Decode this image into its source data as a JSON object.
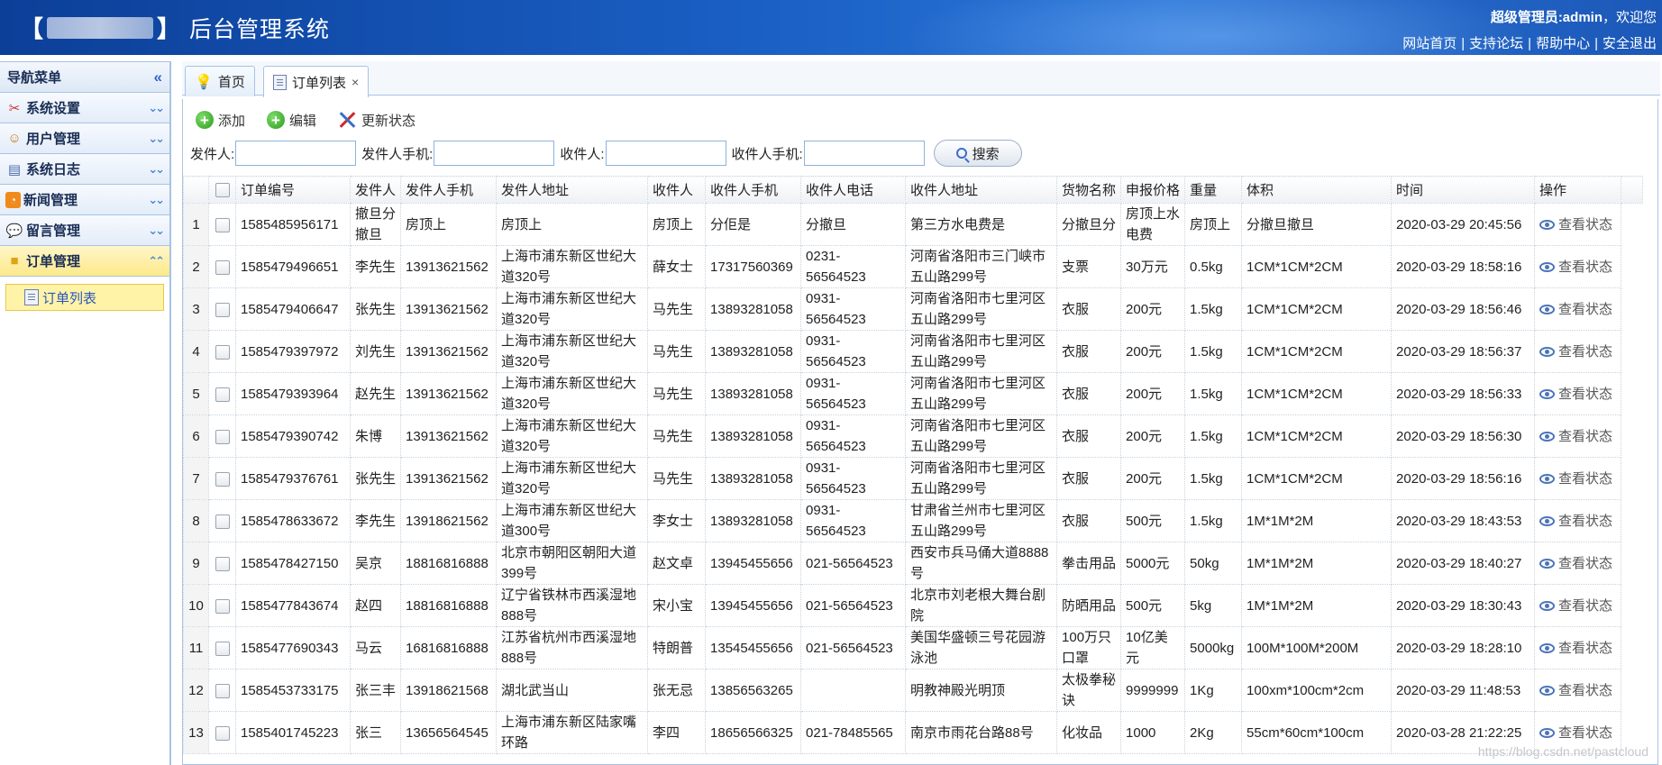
{
  "header": {
    "brand_bracket_left": "【",
    "brand_bracket_right": "】",
    "title": "后台管理系统",
    "welcome_user": "超级管理员:admin",
    "welcome_suffix": "，欢迎您",
    "links": [
      "网站首页",
      "支持论坛",
      "帮助中心",
      "安全退出"
    ]
  },
  "sidebar": {
    "title": "导航菜单",
    "items": [
      {
        "label": "系统设置",
        "icon": "tools-icon"
      },
      {
        "label": "用户管理",
        "icon": "users-icon"
      },
      {
        "label": "系统日志",
        "icon": "log-icon"
      },
      {
        "label": "新闻管理",
        "icon": "rss-icon"
      },
      {
        "label": "留言管理",
        "icon": "comment-icon"
      },
      {
        "label": "订单管理",
        "icon": "folder-icon"
      }
    ],
    "sub_item": "订单列表"
  },
  "tabs": [
    {
      "label": "首页"
    },
    {
      "label": "订单列表"
    }
  ],
  "toolbar": {
    "add": "添加",
    "edit": "编辑",
    "update_status": "更新状态"
  },
  "search": {
    "sender_label": "发件人:",
    "sender_phone_label": "发件人手机:",
    "receiver_label": "收件人:",
    "receiver_phone_label": "收件人手机:",
    "button": "搜索"
  },
  "table": {
    "columns": [
      "订单编号",
      "发件人",
      "发件人手机",
      "发件人地址",
      "收件人",
      "收件人手机",
      "收件人电话",
      "收件人地址",
      "货物名称",
      "申报价格",
      "重量",
      "体积",
      "时间",
      "操作"
    ],
    "action_label": "查看状态",
    "rows": [
      {
        "n": "1",
        "id": "1585485956171",
        "sender": "撤旦分撤旦",
        "sphone": "房顶上",
        "saddr": "房顶上",
        "receiver": "房顶上",
        "rphone": "分佢是",
        "rtel": "分撤旦",
        "raddr": "第三方水电费是",
        "goods": "分撤旦分",
        "price": "房顶上水电费",
        "weight": "房顶上",
        "volume": "分撤旦撤旦",
        "time": "2020-03-29 20:45:56"
      },
      {
        "n": "2",
        "id": "1585479496651",
        "sender": "李先生",
        "sphone": "13913621562",
        "saddr": "上海市浦东新区世纪大道320号",
        "receiver": "薛女士",
        "rphone": "17317560369",
        "rtel": "0231-56564523",
        "raddr": "河南省洛阳市三门峡市五山路299号",
        "goods": "支票",
        "price": "30万元",
        "weight": "0.5kg",
        "volume": "1CM*1CM*2CM",
        "time": "2020-03-29 18:58:16"
      },
      {
        "n": "3",
        "id": "1585479406647",
        "sender": "张先生",
        "sphone": "13913621562",
        "saddr": "上海市浦东新区世纪大道320号",
        "receiver": "马先生",
        "rphone": "13893281058",
        "rtel": "0931-56564523",
        "raddr": "河南省洛阳市七里河区五山路299号",
        "goods": "衣服",
        "price": "200元",
        "weight": "1.5kg",
        "volume": "1CM*1CM*2CM",
        "time": "2020-03-29 18:56:46"
      },
      {
        "n": "4",
        "id": "1585479397972",
        "sender": "刘先生",
        "sphone": "13913621562",
        "saddr": "上海市浦东新区世纪大道320号",
        "receiver": "马先生",
        "rphone": "13893281058",
        "rtel": "0931-56564523",
        "raddr": "河南省洛阳市七里河区五山路299号",
        "goods": "衣服",
        "price": "200元",
        "weight": "1.5kg",
        "volume": "1CM*1CM*2CM",
        "time": "2020-03-29 18:56:37"
      },
      {
        "n": "5",
        "id": "1585479393964",
        "sender": "赵先生",
        "sphone": "13913621562",
        "saddr": "上海市浦东新区世纪大道320号",
        "receiver": "马先生",
        "rphone": "13893281058",
        "rtel": "0931-56564523",
        "raddr": "河南省洛阳市七里河区五山路299号",
        "goods": "衣服",
        "price": "200元",
        "weight": "1.5kg",
        "volume": "1CM*1CM*2CM",
        "time": "2020-03-29 18:56:33"
      },
      {
        "n": "6",
        "id": "1585479390742",
        "sender": "朱博",
        "sphone": "13913621562",
        "saddr": "上海市浦东新区世纪大道320号",
        "receiver": "马先生",
        "rphone": "13893281058",
        "rtel": "0931-56564523",
        "raddr": "河南省洛阳市七里河区五山路299号",
        "goods": "衣服",
        "price": "200元",
        "weight": "1.5kg",
        "volume": "1CM*1CM*2CM",
        "time": "2020-03-29 18:56:30"
      },
      {
        "n": "7",
        "id": "1585479376761",
        "sender": "张先生",
        "sphone": "13913621562",
        "saddr": "上海市浦东新区世纪大道320号",
        "receiver": "马先生",
        "rphone": "13893281058",
        "rtel": "0931-56564523",
        "raddr": "河南省洛阳市七里河区五山路299号",
        "goods": "衣服",
        "price": "200元",
        "weight": "1.5kg",
        "volume": "1CM*1CM*2CM",
        "time": "2020-03-29 18:56:16"
      },
      {
        "n": "8",
        "id": "1585478633672",
        "sender": "李先生",
        "sphone": "13918621562",
        "saddr": "上海市浦东新区世纪大道300号",
        "receiver": "李女士",
        "rphone": "13893281058",
        "rtel": "0931-56564523",
        "raddr": "甘肃省兰州市七里河区五山路299号",
        "goods": "衣服",
        "price": "500元",
        "weight": "1.5kg",
        "volume": "1M*1M*2M",
        "time": "2020-03-29 18:43:53"
      },
      {
        "n": "9",
        "id": "1585478427150",
        "sender": "吴京",
        "sphone": "18816816888",
        "saddr": "北京市朝阳区朝阳大道399号",
        "receiver": "赵文卓",
        "rphone": "13945455656",
        "rtel": "021-56564523",
        "raddr": "西安市兵马俑大道8888号",
        "goods": "拳击用品",
        "price": "5000元",
        "weight": "50kg",
        "volume": "1M*1M*2M",
        "time": "2020-03-29 18:40:27"
      },
      {
        "n": "10",
        "id": "1585477843674",
        "sender": "赵四",
        "sphone": "18816816888",
        "saddr": "辽宁省铁林市西溪湿地888号",
        "receiver": "宋小宝",
        "rphone": "13945455656",
        "rtel": "021-56564523",
        "raddr": "北京市刘老根大舞台剧院",
        "goods": "防晒用品",
        "price": "500元",
        "weight": "5kg",
        "volume": "1M*1M*2M",
        "time": "2020-03-29 18:30:43"
      },
      {
        "n": "11",
        "id": "1585477690343",
        "sender": "马云",
        "sphone": "16816816888",
        "saddr": "江苏省杭州市西溪湿地888号",
        "receiver": "特朗普",
        "rphone": "13545455656",
        "rtel": "021-56564523",
        "raddr": "美国华盛顿三号花园游泳池",
        "goods": "100万只口罩",
        "price": "10亿美元",
        "weight": "5000kg",
        "volume": "100M*100M*200M",
        "time": "2020-03-29 18:28:10"
      },
      {
        "n": "12",
        "id": "1585453733175",
        "sender": "张三丰",
        "sphone": "13918621568",
        "saddr": "湖北武当山",
        "receiver": "张无忌",
        "rphone": "13856563265",
        "rtel": "",
        "raddr": "明教神殿光明顶",
        "goods": "太极拳秘诀",
        "price": "9999999",
        "weight": "1Kg",
        "volume": "100xm*100cm*2cm",
        "time": "2020-03-29 11:48:53"
      },
      {
        "n": "13",
        "id": "1585401745223",
        "sender": "张三",
        "sphone": "13656564545",
        "saddr": "上海市浦东新区陆家嘴环路",
        "receiver": "李四",
        "rphone": "18656566325",
        "rtel": "021-78485565",
        "raddr": "南京市雨花台路88号",
        "goods": "化妆品",
        "price": "1000",
        "weight": "2Kg",
        "volume": "55cm*60cm*100cm",
        "time": "2020-03-28 21:22:25"
      }
    ]
  },
  "watermark": "https://blog.csdn.net/pastcloud"
}
